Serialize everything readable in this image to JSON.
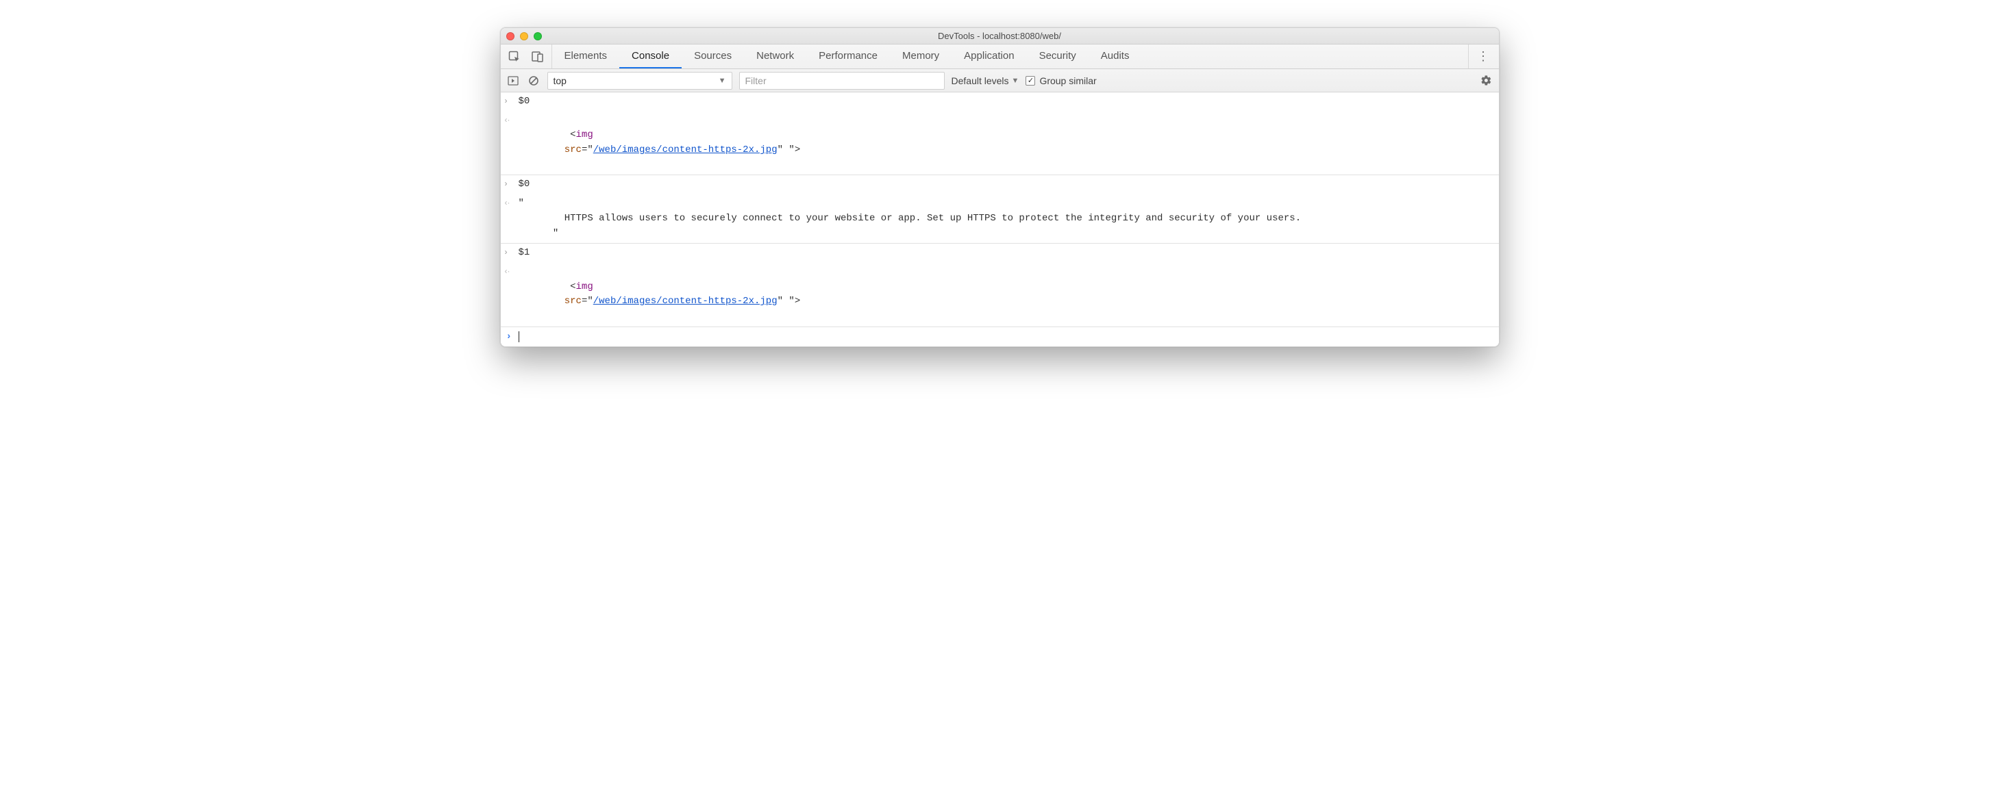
{
  "window": {
    "title": "DevTools - localhost:8080/web/"
  },
  "tabs": {
    "items": [
      "Elements",
      "Console",
      "Sources",
      "Network",
      "Performance",
      "Memory",
      "Application",
      "Security",
      "Audits"
    ],
    "active": "Console"
  },
  "toolbar": {
    "context": "top",
    "filter_placeholder": "Filter",
    "levels_label": "Default levels",
    "group_similar_label": "Group similar",
    "group_similar_checked": true
  },
  "console": {
    "entries": [
      {
        "kind": "input",
        "text": "$0"
      },
      {
        "kind": "output-html",
        "tag": "img",
        "attr": "src",
        "url": "/web/images/content-https-2x.jpg",
        "trailing": " \""
      },
      {
        "kind": "input",
        "text": "$0"
      },
      {
        "kind": "output-text",
        "text": "\"\n        HTTPS allows users to securely connect to your website or app. Set up HTTPS to protect the integrity and security of your users.\n      \""
      },
      {
        "kind": "input",
        "text": "$1"
      },
      {
        "kind": "output-html",
        "tag": "img",
        "attr": "src",
        "url": "/web/images/content-https-2x.jpg",
        "trailing": " \""
      }
    ]
  },
  "glyphs": {
    "input_caret": "›",
    "output_caret": "‹·",
    "prompt_caret": "›"
  }
}
